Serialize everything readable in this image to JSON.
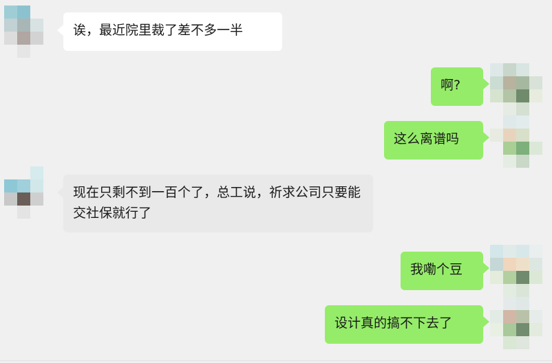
{
  "messages": [
    {
      "side": "incoming",
      "text": "诶，最近院里裁了差不多一半"
    },
    {
      "side": "outgoing",
      "text": "啊?"
    },
    {
      "side": "outgoing",
      "text": "这么离谱吗"
    },
    {
      "side": "incoming",
      "text": "现在只剩不到一百个了，总工说，祈求公司只要能交社保就行了"
    },
    {
      "side": "outgoing",
      "text": "我嘞个豆"
    },
    {
      "side": "outgoing",
      "text": "设计真的搞不下去了"
    }
  ],
  "colors": {
    "background": "#f0f0f0",
    "incoming_bubble": "#ffffff",
    "incoming_bubble_alt": "#e9e9e9",
    "outgoing_bubble": "#95ec69",
    "text": "#1a1a1a"
  }
}
